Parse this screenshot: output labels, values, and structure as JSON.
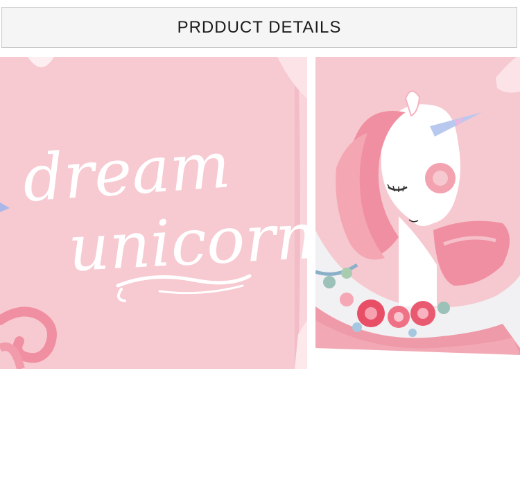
{
  "header": {
    "title": "PRDDUCT DETAILS"
  },
  "left_photo": {
    "line1": "dream",
    "line2": "unicorn"
  },
  "colors": {
    "pink_bg": "#f6c6cf",
    "pink_dark": "#ee9aa8",
    "header_bg": "#f5f5f5"
  }
}
